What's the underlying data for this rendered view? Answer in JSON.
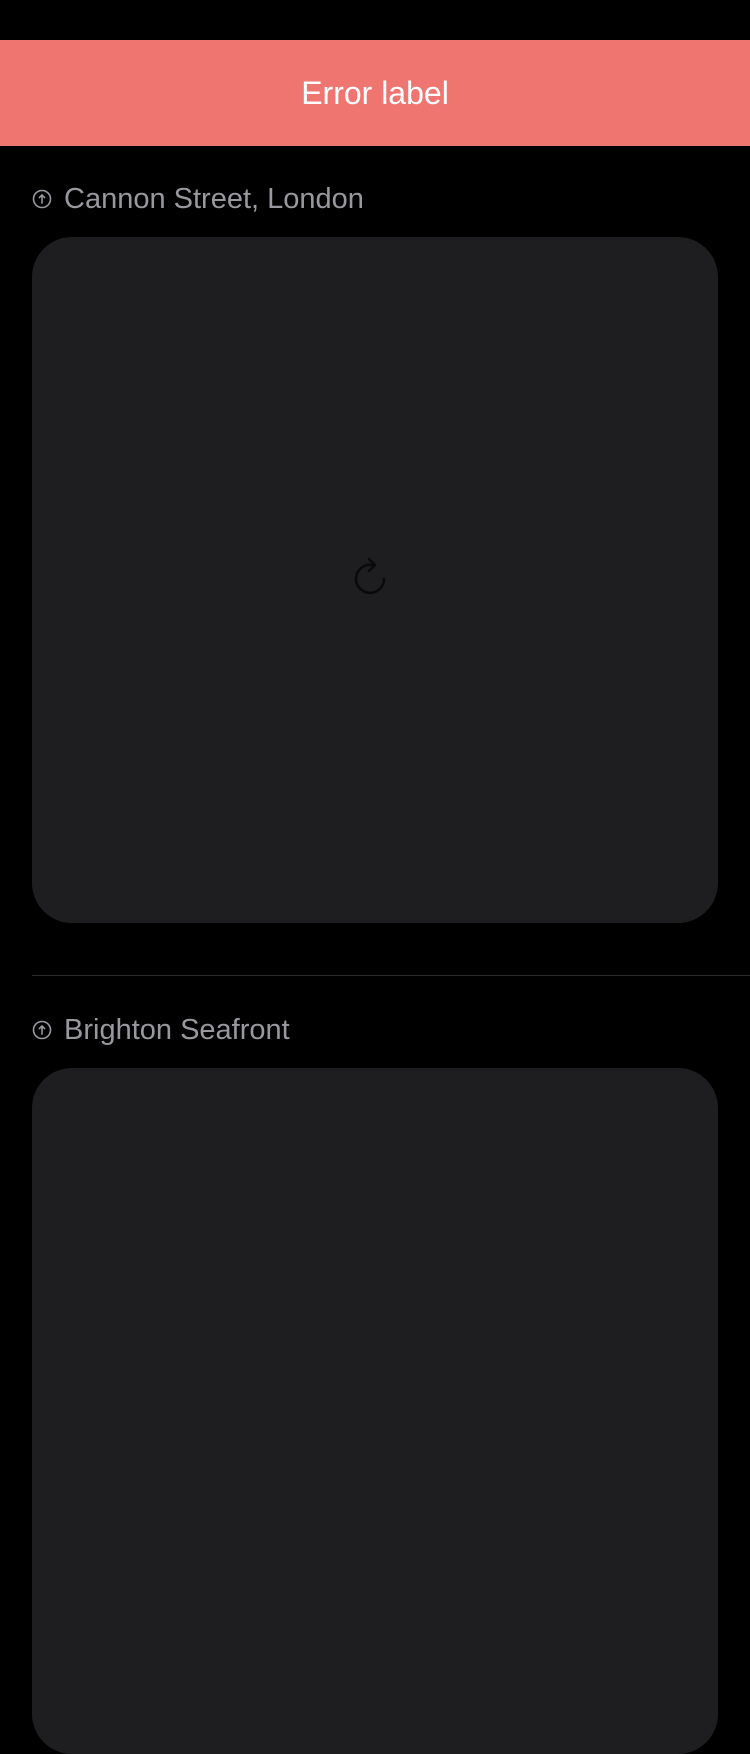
{
  "banner": {
    "error_label": "Error label",
    "background_color": "#EF7570"
  },
  "feed": {
    "items": [
      {
        "location": "Cannon Street, London",
        "image_state": "loading",
        "icon": "refresh-icon"
      },
      {
        "location": "Brighton Seafront",
        "image_state": "empty"
      }
    ]
  },
  "colors": {
    "background": "#000000",
    "card": "#1E1E20",
    "label": "#98989E"
  }
}
